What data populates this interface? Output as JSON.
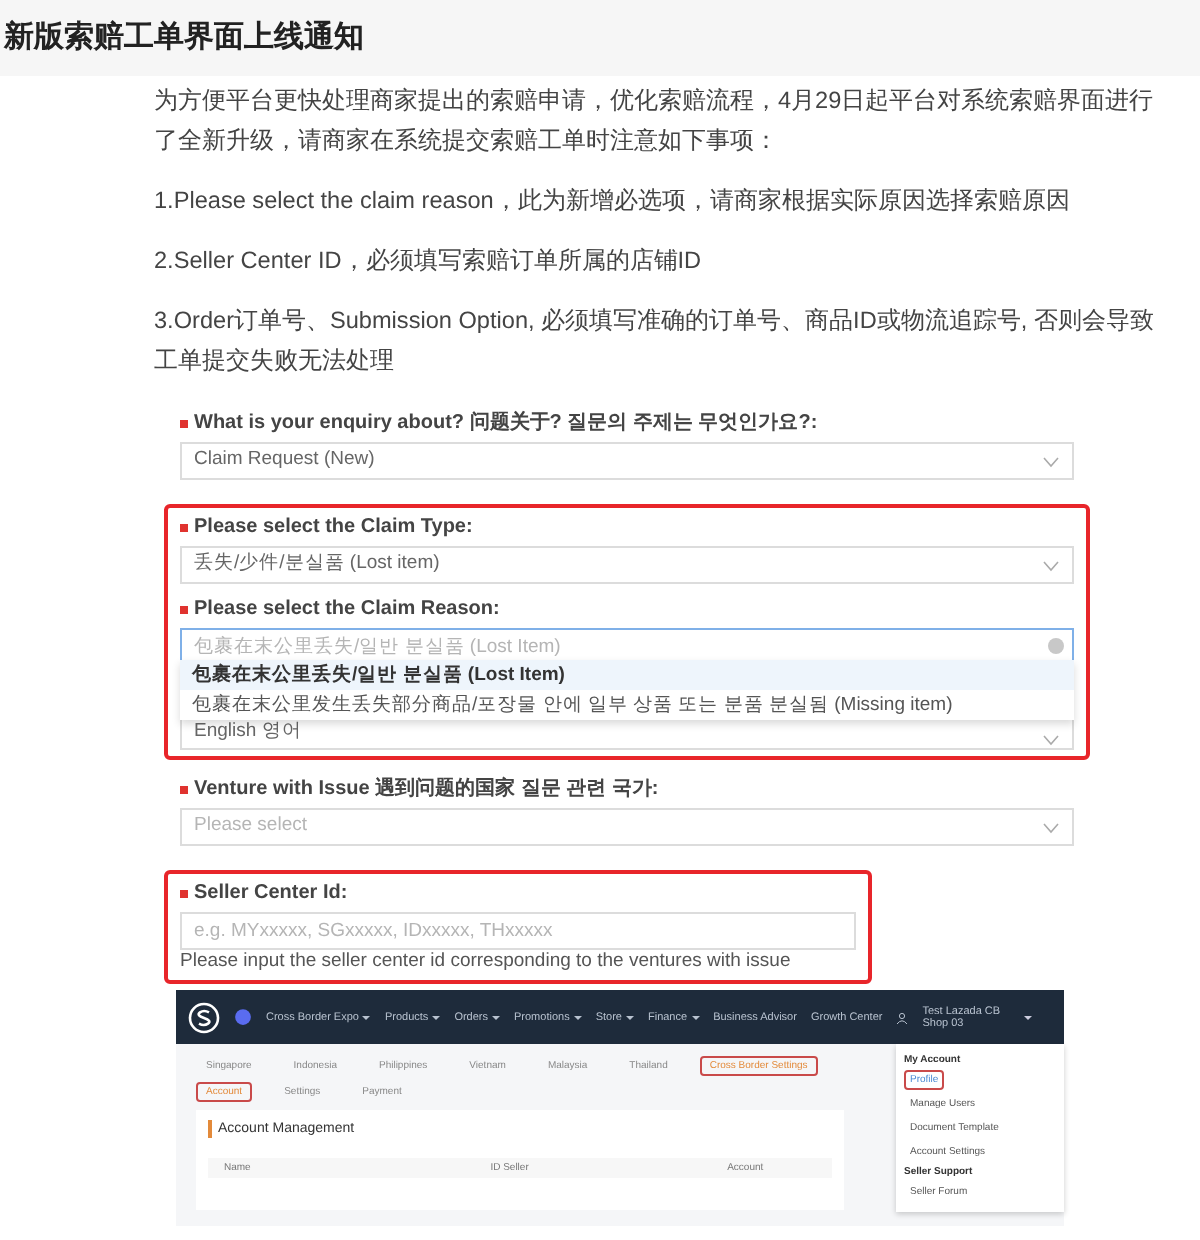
{
  "header": {
    "title": "新版索赔工单界面上线通知"
  },
  "paragraphs": [
    "为方便平台更快处理商家提出的索赔申请，优化索赔流程，4月29日起平台对系统索赔界面进行了全新升级，请商家在系统提交索赔工单时注意如下事项：",
    "1.Please select the claim reason，此为新增必选项，请商家根据实际原因选择索赔原因",
    "2.Seller Center ID，必须填写索赔订单所属的店铺ID",
    "3.Order订单号、Submission Option, 必须填写准确的订单号、商品ID或物流追踪号, 否则会导致工单提交失败无法处理"
  ],
  "form": {
    "sections": [
      {
        "highlighted": false,
        "fields": [
          {
            "kind": "select",
            "required": true,
            "label": "What is your enquiry about? 问题关于? 질문의 주제는 무엇인가요?:",
            "value": "Claim Request (New)"
          }
        ]
      },
      {
        "highlighted": true,
        "fields": [
          {
            "kind": "select",
            "required": true,
            "label": "Please select the Claim Type:",
            "value": "丢失/少件/분실품 (Lost item)"
          },
          {
            "kind": "search",
            "required": true,
            "label": "Please select the Claim Reason:",
            "placeholder": "包裹在末公里丢失/일반 분실품 (Lost Item)",
            "options": [
              {
                "label": "包裹在末公里丢失/일반 분실품 (Lost Item)",
                "selected": true
              },
              {
                "label": "包裹在末公里发生丢失部分商品/포장물 안에 일부 상품 또는 분품 분실됨 (Missing item)",
                "selected": false
              }
            ]
          },
          {
            "kind": "select",
            "value": "English 영어"
          }
        ]
      },
      {
        "highlighted": false,
        "fields": [
          {
            "kind": "select",
            "required": true,
            "label": "Venture with Issue 遇到问题的国家 질문 관련 국가:",
            "placeholder": "Please select"
          }
        ]
      },
      {
        "highlighted": true,
        "fields": [
          {
            "kind": "text",
            "required": true,
            "label": "Seller Center Id:",
            "placeholder": "e.g. MYxxxxx, SGxxxxx, IDxxxxx, THxxxxx",
            "help": "Please input the seller center id corresponding to the ventures with issue"
          }
        ]
      }
    ]
  },
  "seller_center": {
    "brand": "Cross Border Expo",
    "nav": [
      {
        "label": "Products",
        "dropdown": true
      },
      {
        "label": "Orders",
        "dropdown": true
      },
      {
        "label": "Promotions",
        "dropdown": true
      },
      {
        "label": "Store",
        "dropdown": true
      },
      {
        "label": "Finance",
        "dropdown": true
      },
      {
        "label": "Business Advisor",
        "dropdown": false
      },
      {
        "label": "Growth Center",
        "dropdown": false
      }
    ],
    "user": "Test Lazada CB Shop 03",
    "country_tabs": [
      {
        "label": "Singapore",
        "selected": false
      },
      {
        "label": "Indonesia",
        "selected": false
      },
      {
        "label": "Philippines",
        "selected": false
      },
      {
        "label": "Vietnam",
        "selected": false
      },
      {
        "label": "Malaysia",
        "selected": false
      },
      {
        "label": "Thailand",
        "selected": false
      },
      {
        "label": "Cross Border Settings",
        "selected": true
      }
    ],
    "sub_tabs": [
      {
        "label": "Account",
        "selected": true
      },
      {
        "label": "Settings",
        "selected": false
      },
      {
        "label": "Payment",
        "selected": false
      }
    ],
    "card_title": "Account Management",
    "columns": [
      "Name",
      "ID Seller",
      "Account"
    ],
    "menu": [
      {
        "kind": "heading",
        "label": "My Account"
      },
      {
        "kind": "item",
        "label": "Profile",
        "selected": true
      },
      {
        "kind": "item",
        "label": "Manage Users",
        "selected": false
      },
      {
        "kind": "item",
        "label": "Document Template",
        "selected": false
      },
      {
        "kind": "item",
        "label": "Account Settings",
        "selected": false
      },
      {
        "kind": "heading",
        "label": "Seller Support"
      },
      {
        "kind": "item",
        "label": "Seller Forum",
        "selected": false
      }
    ]
  }
}
